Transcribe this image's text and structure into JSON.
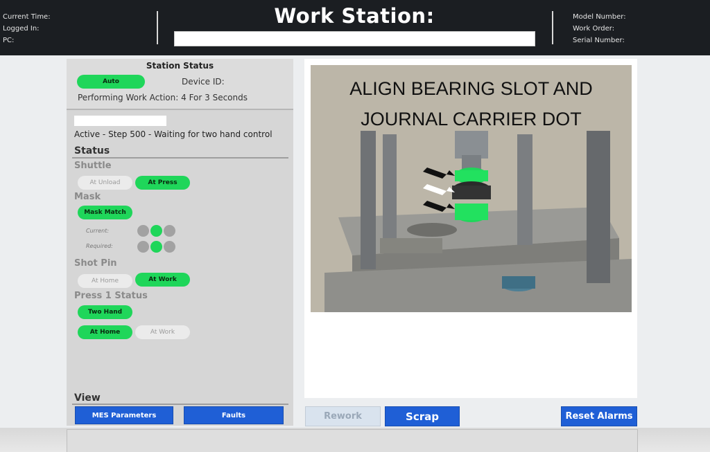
{
  "header": {
    "current_time_label": "Current Time:",
    "logged_in_label": "Logged In:",
    "pc_label": "PC:",
    "title": "Work Station:",
    "model_number_label": "Model Number:",
    "work_order_label": "Work Order:",
    "serial_number_label": "Serial Number:"
  },
  "station_status": {
    "title": "Station Status",
    "mode": "Auto",
    "device_id_label": "Device ID:",
    "performing": "Performing Work Action: 4 For 3 Seconds"
  },
  "active_step": "Active - Step 500 - Waiting for two hand control",
  "status": {
    "title": "Status",
    "shuttle": {
      "title": "Shuttle",
      "at_unload": "At Unload",
      "at_press": "At Press"
    },
    "mask": {
      "title": "Mask",
      "mask_match": "Mask Match",
      "current_label": "Current:",
      "required_label": "Required:",
      "current": [
        false,
        true,
        false
      ],
      "required": [
        false,
        true,
        false
      ]
    },
    "shot_pin": {
      "title": "Shot Pin",
      "at_home": "At Home",
      "at_work": "At Work"
    },
    "press1": {
      "title": "Press 1 Status",
      "two_hand": "Two Hand",
      "at_home": "At Home",
      "at_work": "At Work"
    }
  },
  "view": {
    "title": "View",
    "mes_parameters": "MES Parameters",
    "faults": "Faults"
  },
  "instruction": {
    "caption_line1": "ALIGN BEARING SLOT AND",
    "caption_line2": "JOURNAL CARRIER DOT"
  },
  "actions": {
    "rework": "Rework",
    "scrap": "Scrap",
    "reset_alarms": "Reset Alarms"
  },
  "colors": {
    "indicator_on": "#1fd65a",
    "indicator_off": "#ebebeb",
    "button_blue": "#1f5fd6",
    "header_bg": "#1b1e22"
  }
}
